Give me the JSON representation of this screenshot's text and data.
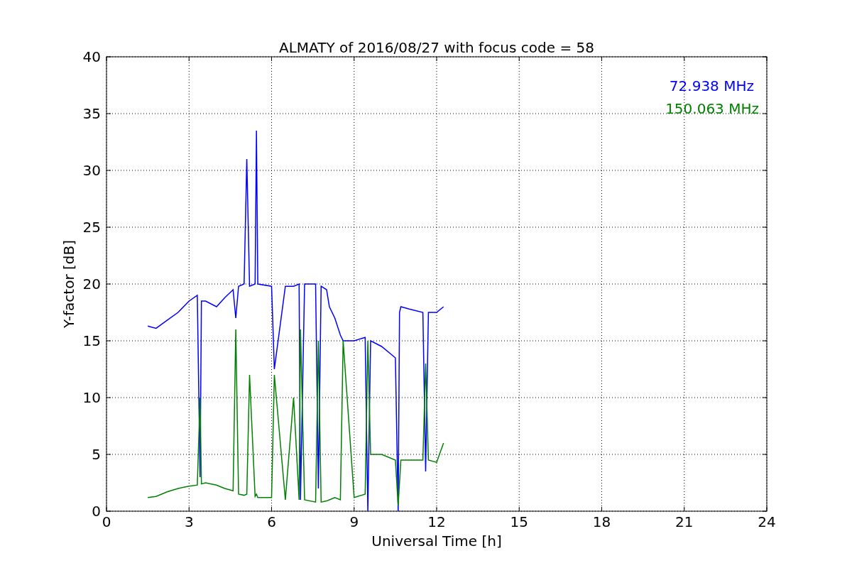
{
  "figure": {
    "chart_data": {
      "type": "line",
      "title": "ALMATY of 2016/08/27 with focus code = 58",
      "xlabel": "Universal Time [h]",
      "ylabel": "Y-factor [dB]",
      "x": [
        1.5,
        1.8,
        2.2,
        2.6,
        3.0,
        3.3,
        3.4,
        3.45,
        3.6,
        4.0,
        4.3,
        4.6,
        4.7,
        4.8,
        5.0,
        5.1,
        5.2,
        5.4,
        5.45,
        5.5,
        6.0,
        6.1,
        6.5,
        6.8,
        7.0,
        7.05,
        7.2,
        7.6,
        7.7,
        7.8,
        8.0,
        8.1,
        8.3,
        8.5,
        8.6,
        9.0,
        9.4,
        9.5,
        9.6,
        10.0,
        10.5,
        10.6,
        10.65,
        10.7,
        11.0,
        11.5,
        11.6,
        11.7,
        12.0,
        12.25
      ],
      "series": [
        {
          "name": "72.938 MHz",
          "color": "#0000ff",
          "values": [
            16.3,
            16.1,
            16.8,
            17.5,
            18.5,
            19.0,
            3.0,
            18.5,
            18.5,
            18.0,
            18.8,
            19.5,
            17.0,
            19.8,
            20.0,
            31.0,
            19.8,
            20.0,
            33.5,
            20.0,
            19.8,
            12.5,
            19.8,
            19.8,
            20.0,
            1.0,
            20.0,
            20.0,
            2.0,
            19.8,
            19.5,
            18.0,
            17.0,
            15.5,
            15.0,
            15.0,
            15.3,
            0.0,
            15.0,
            14.5,
            13.5,
            0.0,
            17.5,
            18.0,
            17.8,
            17.5,
            3.5,
            17.5,
            17.5,
            18.0
          ]
        },
        {
          "name": "150.063 MHz",
          "color": "#008000",
          "values": [
            1.2,
            1.3,
            1.7,
            2.0,
            2.2,
            2.3,
            10.0,
            2.4,
            2.5,
            2.3,
            2.0,
            1.8,
            16.0,
            1.5,
            1.4,
            1.5,
            12.0,
            1.3,
            1.5,
            1.2,
            1.2,
            12.0,
            1.0,
            10.0,
            1.0,
            16.0,
            1.0,
            0.8,
            15.0,
            0.8,
            0.9,
            1.0,
            1.2,
            1.0,
            15.0,
            1.2,
            1.5,
            15.0,
            5.0,
            5.0,
            4.5,
            0.5,
            2.5,
            4.5,
            4.5,
            4.5,
            13.0,
            4.5,
            4.3,
            6.0
          ]
        }
      ],
      "grid": true,
      "xlim": [
        0,
        24
      ],
      "ylim": [
        0,
        40
      ],
      "xticks": [
        0,
        3,
        6,
        9,
        12,
        15,
        18,
        21,
        24
      ],
      "yticks": [
        0,
        5,
        10,
        15,
        20,
        25,
        30,
        35,
        40
      ]
    }
  }
}
